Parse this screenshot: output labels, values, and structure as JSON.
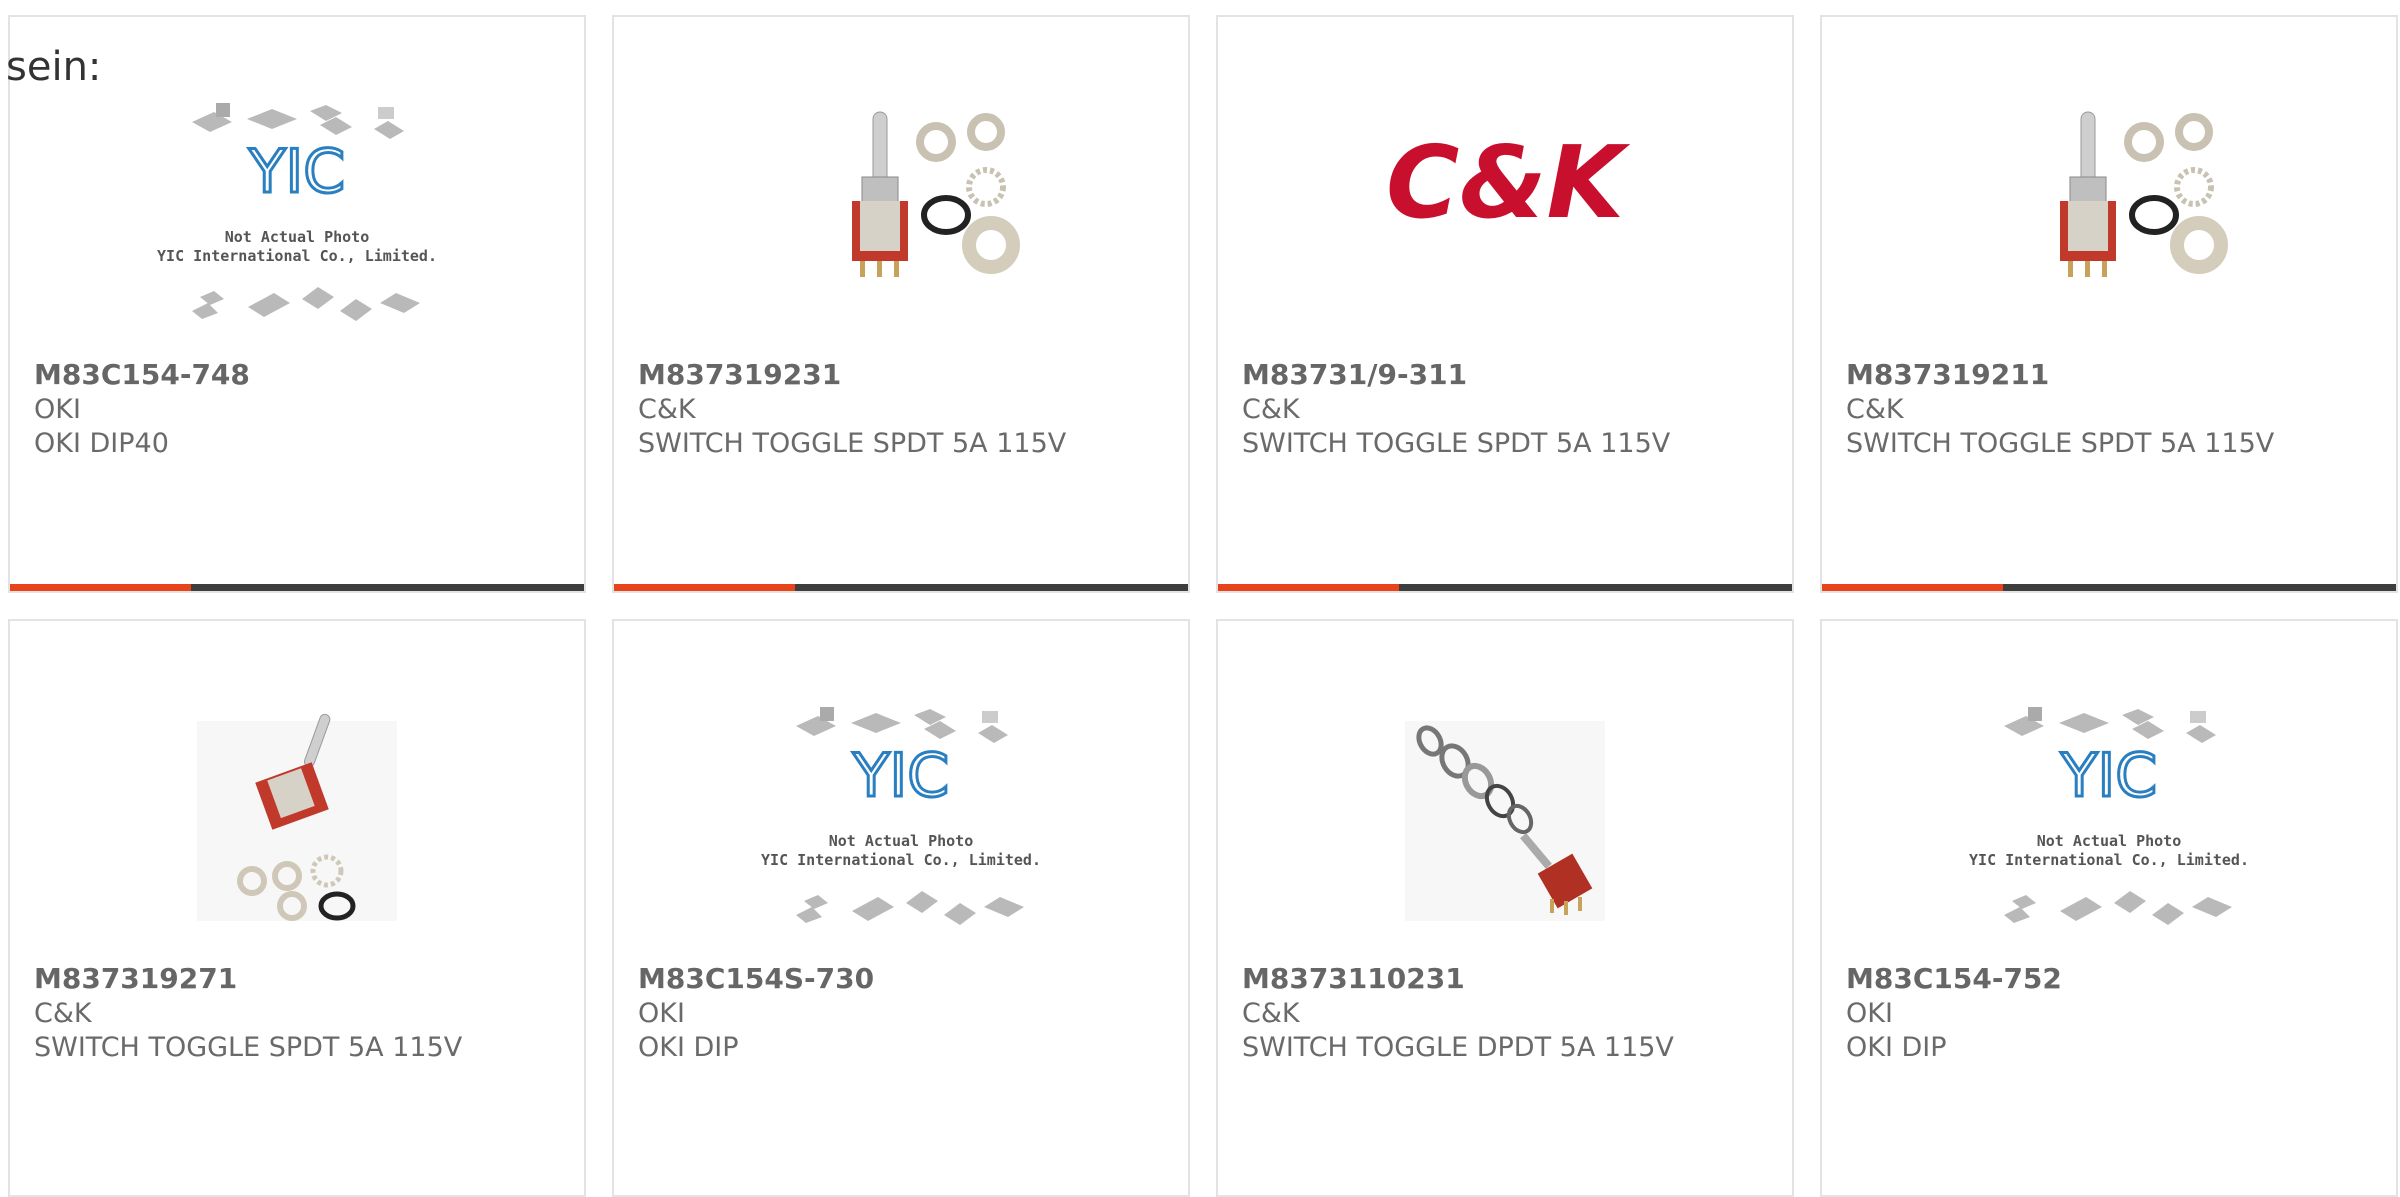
{
  "intro_text": "sein:",
  "colors": {
    "accent": "#e8441c",
    "bar_dark": "#3e3e3e",
    "border": "#e3e3e3",
    "ck_red": "#c8102e"
  },
  "placeholder": {
    "line1": "Not Actual Photo",
    "line2": "YIC International Co., Limited.",
    "logo_letters": "YIC"
  },
  "ck_logo_text": "C&K",
  "products": [
    {
      "part": "M83C154-748",
      "manufacturer": "OKI",
      "description": "OKI DIP40",
      "image": "placeholder-image"
    },
    {
      "part": "M837319231",
      "manufacturer": "C&K",
      "description": "SWITCH TOGGLE SPDT 5A 115V",
      "image": "toggle-switch-image"
    },
    {
      "part": "M83731/9-311",
      "manufacturer": "C&K",
      "description": "SWITCH TOGGLE SPDT 5A 115V",
      "image": "ck-logo-image"
    },
    {
      "part": "M837319211",
      "manufacturer": "C&K",
      "description": "SWITCH TOGGLE SPDT 5A 115V",
      "image": "toggle-switch-image"
    },
    {
      "part": "M837319271",
      "manufacturer": "C&K",
      "description": "SWITCH TOGGLE SPDT 5A 115V",
      "image": "toggle-switch-side-image"
    },
    {
      "part": "M83C154S-730",
      "manufacturer": "OKI",
      "description": "OKI DIP",
      "image": "placeholder-image"
    },
    {
      "part": "M8373110231",
      "manufacturer": "C&K",
      "description": "SWITCH TOGGLE DPDT 5A 115V",
      "image": "toggle-switch-exploded-image"
    },
    {
      "part": "M83C154-752",
      "manufacturer": "OKI",
      "description": "OKI DIP",
      "image": "placeholder-image"
    }
  ]
}
